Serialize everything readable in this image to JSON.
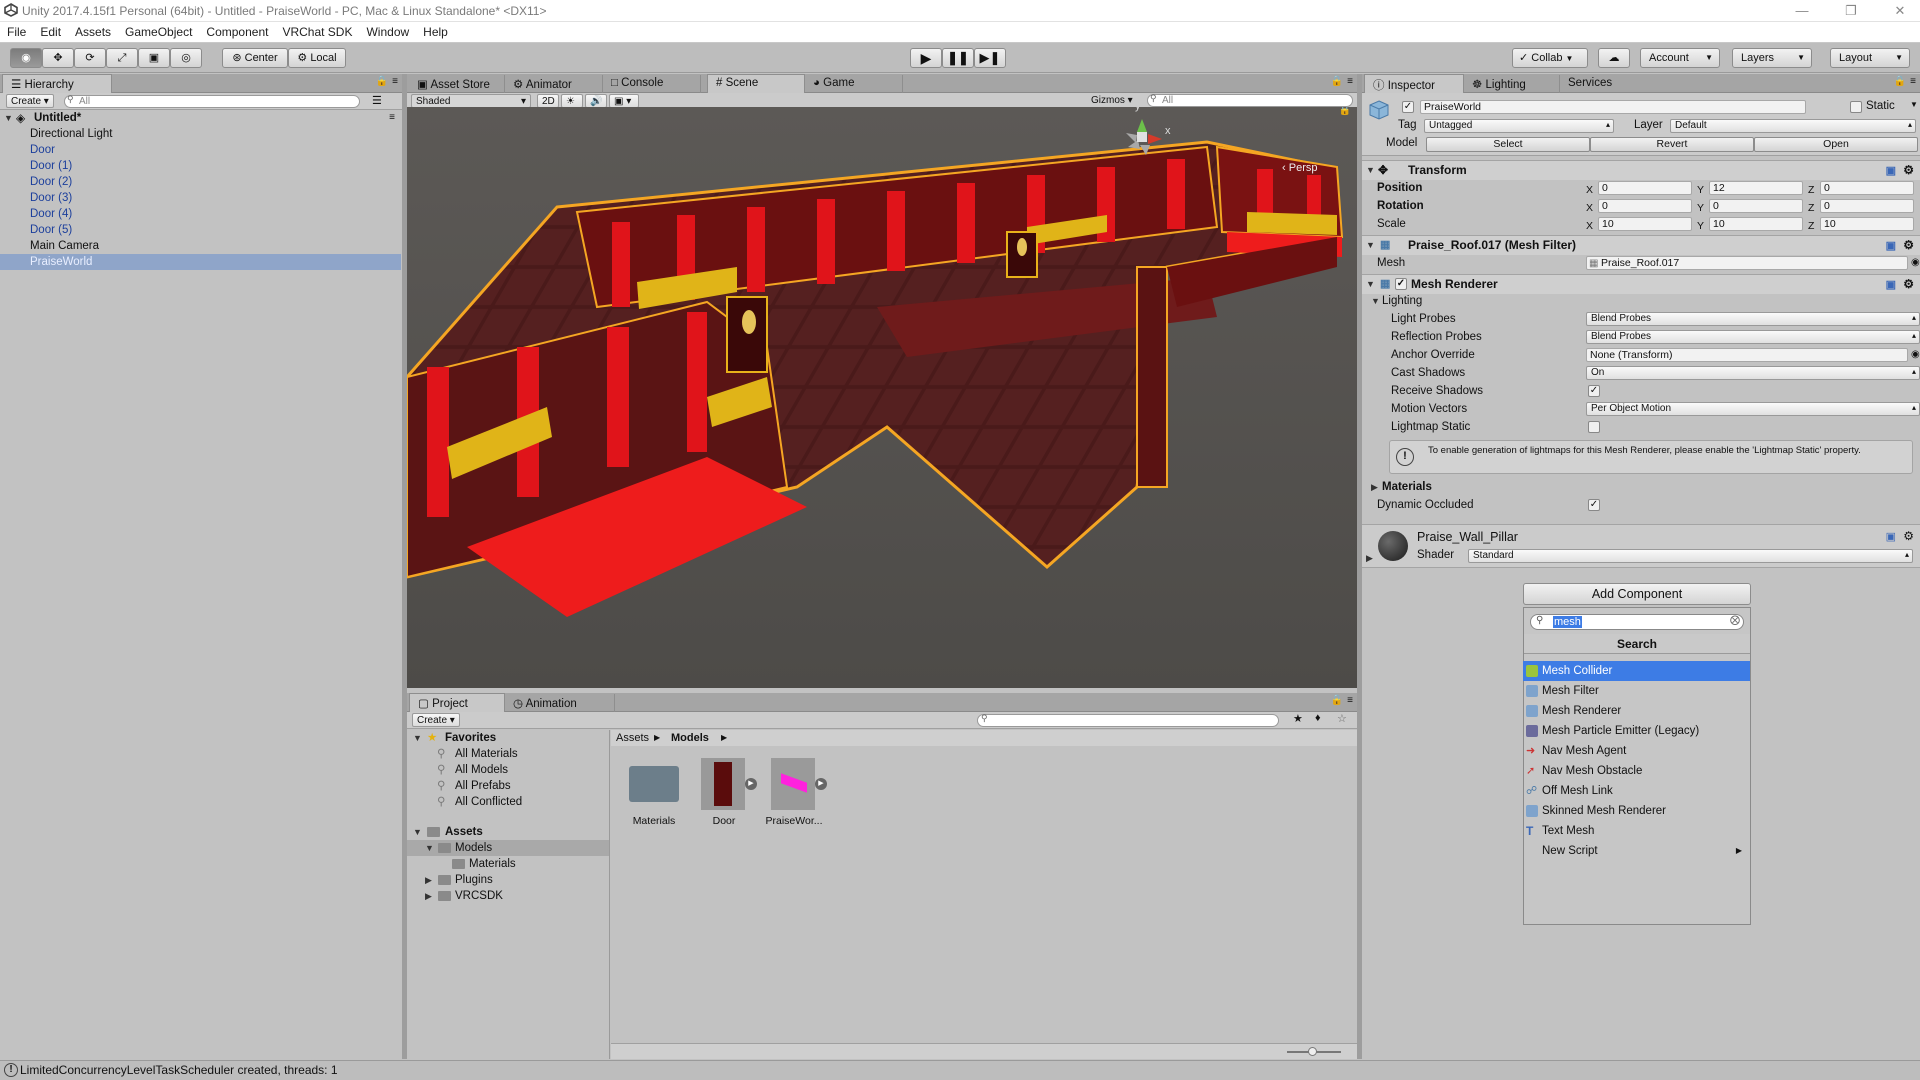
{
  "window": {
    "title": "Unity 2017.4.15f1 Personal (64bit) - Untitled - PraiseWorld - PC, Mac & Linux Standalone* <DX11>"
  },
  "menu": [
    "File",
    "Edit",
    "Assets",
    "GameObject",
    "Component",
    "VRChat SDK",
    "Window",
    "Help"
  ],
  "toolbar": {
    "pivot": "Center",
    "space": "Local",
    "collab": "Collab",
    "account": "Account",
    "layers": "Layers",
    "layout": "Layout"
  },
  "hierarchy": {
    "tab": "Hierarchy",
    "create": "Create",
    "search_placeholder": "All",
    "scene": "Untitled*",
    "items": [
      "Directional Light",
      "Door",
      "Door (1)",
      "Door (2)",
      "Door (3)",
      "Door (4)",
      "Door (5)",
      "Main Camera",
      "PraiseWorld"
    ]
  },
  "center_tabs": [
    "Asset Store",
    "Animator",
    "Console",
    "Scene",
    "Game"
  ],
  "scene_toolbar": {
    "shading": "Shaded",
    "mode2d": "2D",
    "gizmos": "Gizmos",
    "search_placeholder": "All",
    "persp": "Persp",
    "axis_y": "y",
    "axis_x": "x"
  },
  "project": {
    "tabs": [
      "Project",
      "Animation"
    ],
    "create": "Create",
    "favorites_title": "Favorites",
    "favorites": [
      "All Materials",
      "All Models",
      "All Prefabs",
      "All Conflicted"
    ],
    "assets_title": "Assets",
    "tree": [
      "Models",
      "Materials",
      "Plugins",
      "VRCSDK"
    ],
    "breadcrumb": [
      "Assets",
      "Models"
    ],
    "grid": [
      "Materials",
      "Door",
      "PraiseWor..."
    ]
  },
  "inspector": {
    "tabs": [
      "Inspector",
      "Lighting",
      "Services"
    ],
    "object_name": "PraiseWorld",
    "static_label": "Static",
    "tag_label": "Tag",
    "tag_value": "Untagged",
    "layer_label": "Layer",
    "layer_value": "Default",
    "model_label": "Model",
    "model_buttons": [
      "Select",
      "Revert",
      "Open"
    ],
    "transform": {
      "title": "Transform",
      "rows": [
        {
          "label": "Position",
          "x": "0",
          "y": "12",
          "z": "0"
        },
        {
          "label": "Rotation",
          "x": "0",
          "y": "0",
          "z": "0"
        },
        {
          "label": "Scale",
          "x": "10",
          "y": "10",
          "z": "10"
        }
      ]
    },
    "mesh_filter": {
      "title": "Praise_Roof.017 (Mesh Filter)",
      "mesh_label": "Mesh",
      "mesh_value": "Praise_Roof.017"
    },
    "mesh_renderer": {
      "title": "Mesh Renderer",
      "lighting": "Lighting",
      "light_probes_label": "Light Probes",
      "light_probes": "Blend Probes",
      "reflection_probes_label": "Reflection Probes",
      "reflection_probes": "Blend Probes",
      "anchor_override_label": "Anchor Override",
      "anchor_override": "None (Transform)",
      "cast_shadows_label": "Cast Shadows",
      "cast_shadows": "On",
      "receive_shadows_label": "Receive Shadows",
      "motion_vectors_label": "Motion Vectors",
      "motion_vectors": "Per Object Motion",
      "lightmap_static_label": "Lightmap Static",
      "info": "To enable generation of lightmaps for this Mesh Renderer, please enable the 'Lightmap Static' property.",
      "materials": "Materials",
      "dynamic_occluded_label": "Dynamic Occluded"
    },
    "material": {
      "name": "Praise_Wall_Pillar",
      "shader_label": "Shader",
      "shader": "Standard"
    },
    "add_component": "Add Component"
  },
  "add_component_popup": {
    "search_value": "mesh",
    "header": "Search",
    "items": [
      "Mesh Collider",
      "Mesh Filter",
      "Mesh Renderer",
      "Mesh Particle Emitter (Legacy)",
      "Nav Mesh Agent",
      "Nav Mesh Obstacle",
      "Off Mesh Link",
      "Skinned Mesh Renderer",
      "Text Mesh",
      "New Script"
    ],
    "selected": "Mesh Collider"
  },
  "status": {
    "message": "LimitedConcurrencyLevelTaskScheduler created, threads: 1"
  }
}
